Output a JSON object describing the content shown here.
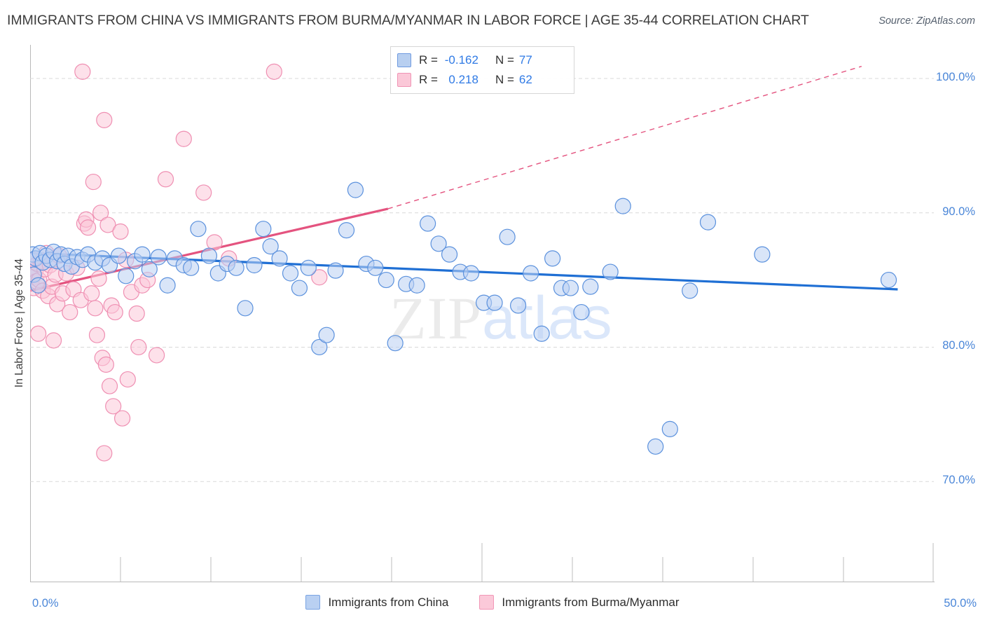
{
  "header": {
    "title": "IMMIGRANTS FROM CHINA VS IMMIGRANTS FROM BURMA/MYANMAR IN LABOR FORCE | AGE 35-44 CORRELATION CHART",
    "source": "Source: ZipAtlas.com"
  },
  "watermark": {
    "part1": "ZIP",
    "part2": "atlas"
  },
  "stats": {
    "series1": {
      "r_label": "R =",
      "r_value": "-0.162",
      "n_label": "N =",
      "n_value": "77"
    },
    "series2": {
      "r_label": "R =",
      "r_value": "0.218",
      "n_label": "N =",
      "n_value": "62"
    }
  },
  "legend": {
    "items": [
      {
        "label": "Immigrants from China",
        "color": "#b9d0f2"
      },
      {
        "label": "Immigrants from Burma/Myanmar",
        "color": "#fbc9d9"
      }
    ]
  },
  "chart_data": {
    "type": "scatter",
    "title": "IMMIGRANTS FROM CHINA VS IMMIGRANTS FROM BURMA/MYANMAR IN LABOR FORCE | AGE 35-44 CORRELATION CHART",
    "xlabel": "",
    "ylabel": "In Labor Force | Age 35-44",
    "xlim": [
      0.0,
      50.0
    ],
    "ylim": [
      62.5,
      102.5
    ],
    "x_ticks": [
      "0.0%",
      "50.0%"
    ],
    "x_tick_values": [
      0.0,
      50.0
    ],
    "y_ticks": [
      "100.0%",
      "90.0%",
      "80.0%",
      "70.0%"
    ],
    "y_tick_values": [
      100.0,
      90.0,
      80.0,
      70.0
    ],
    "grid": "horizontal-dashed",
    "legend_position": "bottom-center",
    "series": [
      {
        "name": "Immigrants from China",
        "color": "#b9d0f2",
        "edge_color": "#5b91dd",
        "R": -0.162,
        "N": 77,
        "trend": {
          "type": "linear",
          "color": "#1f6fd4",
          "x0": 0.0,
          "y0": 87.0,
          "x1": 48.0,
          "y1": 84.3,
          "dashed_from": null
        },
        "points": [
          [
            0.15,
            86.9
          ],
          [
            0.2,
            85.4
          ],
          [
            0.3,
            86.6
          ],
          [
            0.45,
            84.6
          ],
          [
            0.55,
            87.0
          ],
          [
            0.7,
            86.3
          ],
          [
            0.9,
            86.8
          ],
          [
            1.1,
            86.5
          ],
          [
            1.3,
            87.1
          ],
          [
            1.5,
            86.4
          ],
          [
            1.7,
            86.9
          ],
          [
            1.9,
            86.2
          ],
          [
            2.1,
            86.8
          ],
          [
            2.3,
            86.0
          ],
          [
            2.6,
            86.7
          ],
          [
            2.9,
            86.5
          ],
          [
            3.2,
            86.9
          ],
          [
            3.6,
            86.3
          ],
          [
            4.0,
            86.6
          ],
          [
            4.4,
            86.1
          ],
          [
            4.9,
            86.8
          ],
          [
            5.3,
            85.3
          ],
          [
            5.8,
            86.4
          ],
          [
            6.2,
            86.9
          ],
          [
            6.6,
            85.8
          ],
          [
            7.1,
            86.7
          ],
          [
            7.6,
            84.6
          ],
          [
            8.0,
            86.6
          ],
          [
            8.5,
            86.1
          ],
          [
            8.9,
            85.9
          ],
          [
            9.3,
            88.8
          ],
          [
            9.9,
            86.8
          ],
          [
            10.4,
            85.5
          ],
          [
            10.9,
            86.2
          ],
          [
            11.4,
            85.9
          ],
          [
            11.9,
            82.9
          ],
          [
            12.4,
            86.1
          ],
          [
            12.9,
            88.8
          ],
          [
            13.3,
            87.5
          ],
          [
            13.8,
            86.6
          ],
          [
            14.4,
            85.5
          ],
          [
            14.9,
            84.4
          ],
          [
            15.4,
            85.9
          ],
          [
            16.0,
            80.0
          ],
          [
            16.4,
            80.9
          ],
          [
            16.9,
            85.7
          ],
          [
            17.5,
            88.7
          ],
          [
            18.0,
            91.7
          ],
          [
            18.6,
            86.2
          ],
          [
            19.1,
            85.9
          ],
          [
            19.7,
            85.0
          ],
          [
            20.2,
            80.3
          ],
          [
            20.8,
            84.7
          ],
          [
            21.4,
            84.6
          ],
          [
            22.0,
            89.2
          ],
          [
            22.6,
            87.7
          ],
          [
            23.2,
            86.9
          ],
          [
            23.8,
            85.6
          ],
          [
            24.4,
            85.5
          ],
          [
            25.1,
            83.3
          ],
          [
            25.7,
            83.3
          ],
          [
            26.4,
            88.2
          ],
          [
            27.0,
            83.1
          ],
          [
            27.7,
            85.5
          ],
          [
            28.3,
            81.0
          ],
          [
            28.9,
            86.6
          ],
          [
            29.4,
            84.4
          ],
          [
            29.9,
            84.4
          ],
          [
            30.5,
            82.6
          ],
          [
            31.0,
            84.5
          ],
          [
            32.1,
            85.6
          ],
          [
            32.8,
            90.5
          ],
          [
            35.4,
            73.9
          ],
          [
            34.6,
            72.6
          ],
          [
            36.5,
            84.2
          ],
          [
            37.5,
            89.3
          ],
          [
            40.5,
            86.9
          ],
          [
            47.5,
            85.0
          ]
        ]
      },
      {
        "name": "Immigrants from Burma/Myanmar",
        "color": "#fbc9d9",
        "edge_color": "#ef8fb2",
        "R": 0.218,
        "N": 62,
        "trend": {
          "type": "linear",
          "color": "#e4537f",
          "x0": 0.0,
          "y0": 84.2,
          "x1": 19.8,
          "y1": 90.3,
          "dashed_to_x": 46.0,
          "dashed_to_y": 100.9
        },
        "points": [
          [
            0.1,
            86.0
          ],
          [
            0.15,
            85.2
          ],
          [
            0.2,
            84.4
          ],
          [
            0.25,
            86.5
          ],
          [
            0.3,
            85.7
          ],
          [
            0.35,
            84.9
          ],
          [
            0.4,
            86.2
          ],
          [
            0.5,
            85.0
          ],
          [
            0.6,
            86.4
          ],
          [
            0.7,
            84.2
          ],
          [
            0.8,
            85.8
          ],
          [
            0.9,
            87.0
          ],
          [
            1.0,
            83.8
          ],
          [
            1.1,
            86.1
          ],
          [
            1.2,
            84.5
          ],
          [
            1.4,
            85.4
          ],
          [
            1.5,
            83.2
          ],
          [
            1.6,
            86.8
          ],
          [
            1.8,
            84.0
          ],
          [
            2.0,
            85.5
          ],
          [
            2.2,
            82.6
          ],
          [
            2.4,
            84.3
          ],
          [
            2.6,
            85.9
          ],
          [
            2.8,
            83.5
          ],
          [
            3.0,
            89.2
          ],
          [
            3.1,
            89.5
          ],
          [
            3.2,
            88.9
          ],
          [
            3.4,
            84.0
          ],
          [
            3.6,
            82.9
          ],
          [
            3.8,
            85.1
          ],
          [
            1.3,
            80.5
          ],
          [
            2.9,
            100.5
          ],
          [
            3.5,
            92.3
          ],
          [
            3.9,
            90.0
          ],
          [
            4.1,
            96.9
          ],
          [
            4.3,
            89.1
          ],
          [
            4.5,
            83.1
          ],
          [
            4.7,
            82.6
          ],
          [
            4.0,
            79.2
          ],
          [
            4.2,
            78.7
          ],
          [
            4.4,
            77.1
          ],
          [
            4.6,
            75.6
          ],
          [
            4.1,
            72.1
          ],
          [
            3.7,
            80.9
          ],
          [
            5.0,
            88.6
          ],
          [
            5.3,
            86.5
          ],
          [
            5.6,
            84.1
          ],
          [
            5.9,
            82.5
          ],
          [
            5.1,
            74.7
          ],
          [
            5.4,
            77.6
          ],
          [
            6.2,
            84.6
          ],
          [
            6.5,
            85.0
          ],
          [
            6.0,
            80.0
          ],
          [
            7.0,
            79.4
          ],
          [
            7.5,
            92.5
          ],
          [
            8.5,
            95.5
          ],
          [
            9.6,
            91.5
          ],
          [
            10.2,
            87.8
          ],
          [
            11.0,
            86.6
          ],
          [
            13.5,
            100.5
          ],
          [
            16.0,
            85.2
          ],
          [
            0.45,
            81.0
          ]
        ]
      }
    ]
  }
}
